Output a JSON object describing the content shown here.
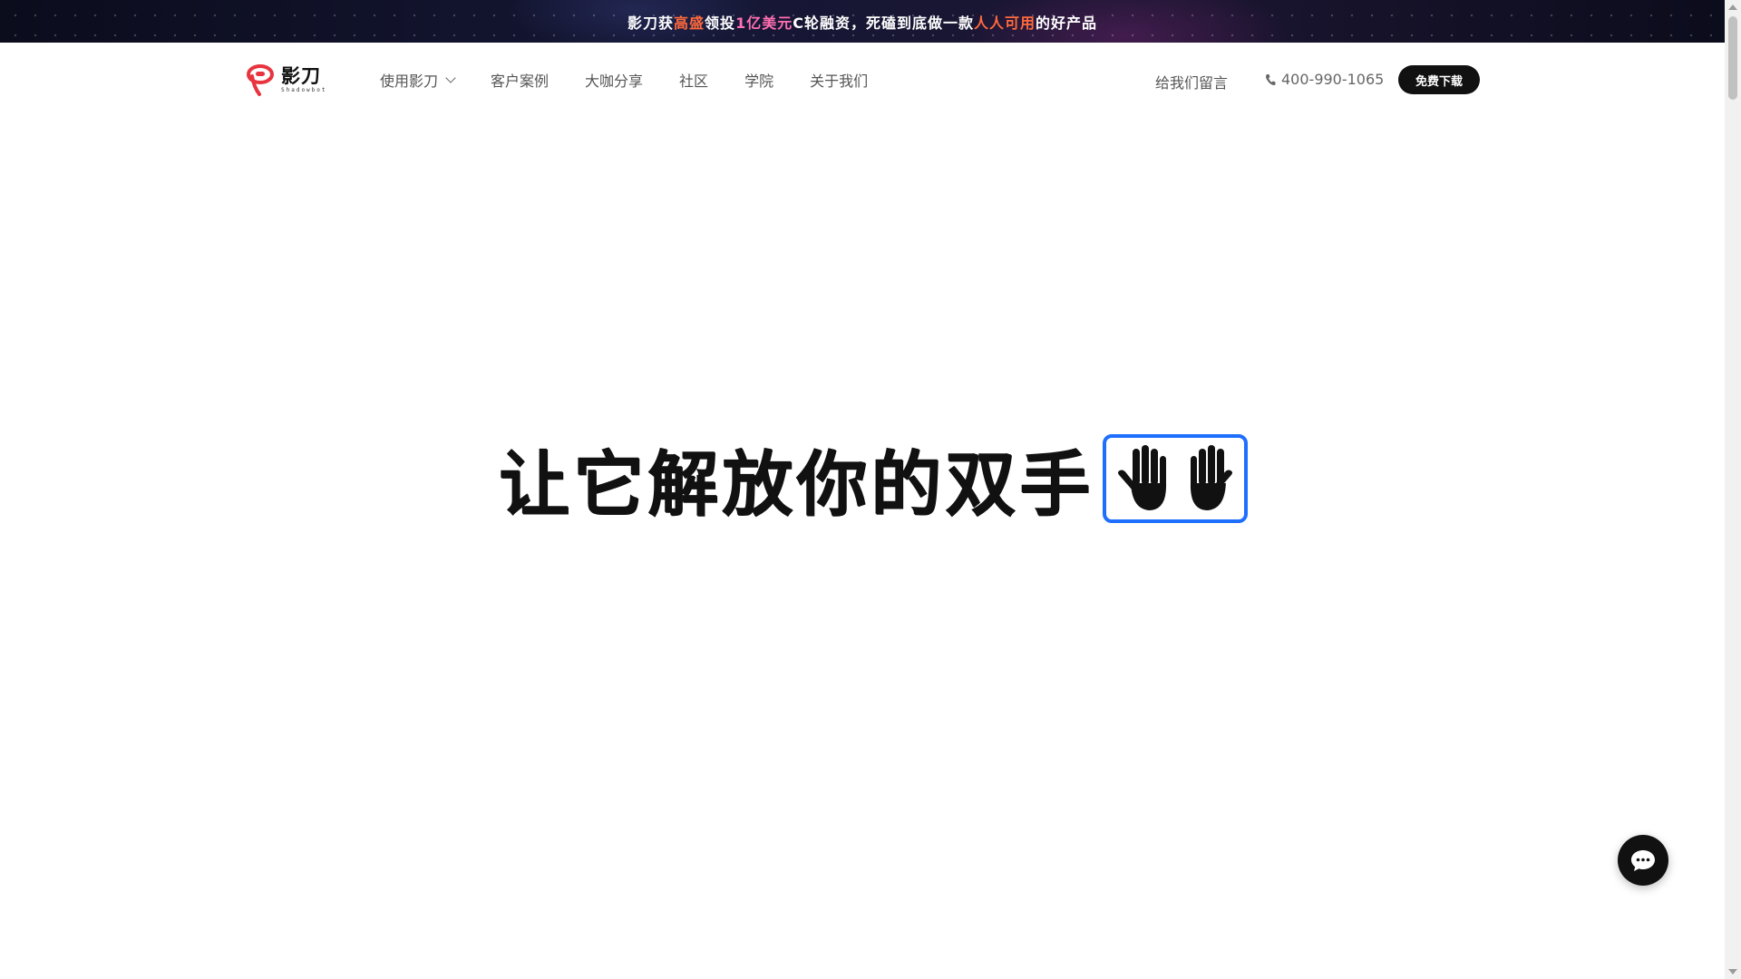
{
  "banner": {
    "part1": "影刀获",
    "highlight1": "高盛",
    "part2": "领投",
    "highlight2": "1亿美元",
    "part3": "C轮融资，死磕到底做一款",
    "highlight3": "人人可用",
    "part4": "的好产品"
  },
  "logo": {
    "name_cn": "影刀",
    "name_en": "Shadowbot"
  },
  "nav": {
    "items": [
      {
        "label": "使用影刀",
        "has_dropdown": true
      },
      {
        "label": "客户案例"
      },
      {
        "label": "大咖分享"
      },
      {
        "label": "社区"
      },
      {
        "label": "学院"
      },
      {
        "label": "关于我们"
      }
    ],
    "message_label": "给我们留言",
    "phone": "400-990-1065",
    "download_label": "免费下载"
  },
  "hero": {
    "title": "让它解放你的双手"
  },
  "colors": {
    "accent_blue": "#1f6fff",
    "brand_red": "#e8343f",
    "banner_orange": "#ff6a3c",
    "banner_pink": "#ff6fb1",
    "banner_purple": "#c08bff"
  },
  "icons": {
    "phone": "phone-icon",
    "chat": "chat-bubble-icon",
    "dropdown": "chevron-down-icon",
    "hands": "hand-icon"
  }
}
